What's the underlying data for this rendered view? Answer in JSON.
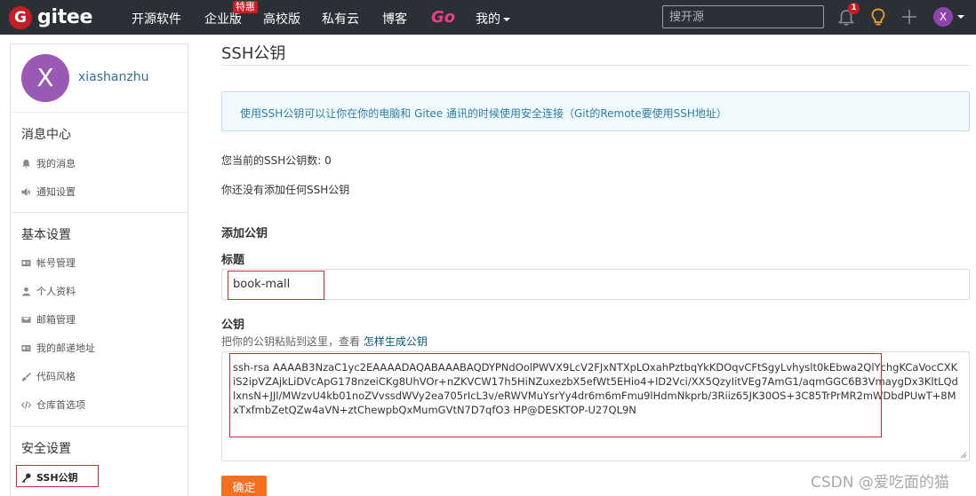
{
  "nav": {
    "brand": "gitee",
    "brand_letter": "G",
    "items": [
      "开源软件",
      "企业版",
      "高校版",
      "私有云",
      "博客"
    ],
    "badge": "特惠",
    "go_label": "Go",
    "mine": "我的",
    "search_placeholder": "搜开源",
    "notification_count": "1",
    "avatar_letter": "X"
  },
  "sidebar": {
    "avatar_letter": "X",
    "username": "xiashanzhu",
    "sections": [
      {
        "title": "消息中心",
        "items": [
          {
            "label": "我的消息",
            "icon": "bell-icon"
          },
          {
            "label": "通知设置",
            "icon": "speaker-icon"
          }
        ]
      },
      {
        "title": "基本设置",
        "items": [
          {
            "label": "帐号管理",
            "icon": "id-card-icon"
          },
          {
            "label": "个人资料",
            "icon": "user-icon"
          },
          {
            "label": "邮箱管理",
            "icon": "mail-icon"
          },
          {
            "label": "我的邮递地址",
            "icon": "address-card-icon"
          },
          {
            "label": "代码风格",
            "icon": "paint-brush-icon"
          },
          {
            "label": "仓库首选项",
            "icon": "code-icon"
          }
        ]
      },
      {
        "title": "安全设置",
        "items": [
          {
            "label": "SSH公钥",
            "icon": "key-icon",
            "active": true
          }
        ]
      }
    ]
  },
  "main": {
    "title": "SSH公钥",
    "info": "使用SSH公钥可以让你在你的电脑和 Gitee 通讯的时候使用安全连接（Git的Remote要使用SSH地址）",
    "key_count_text": "您当前的SSH公钥数: 0",
    "no_key_text": "你还没有添加任何SSH公钥",
    "add_heading": "添加公钥",
    "title_label": "标题",
    "title_value": "book-mall",
    "pubkey_label": "公钥",
    "pubkey_hint": "把你的公钥粘贴到这里，查看",
    "pubkey_hint_link": "怎样生成公钥",
    "pubkey_value": "ssh-rsa AAAAB3NzaC1yc2EAAAADAQABAAABAQDYPNdOolPWVX9LcV2FJxNTXpLOxahPztbqYkKDOqvCFtSgyLvhyslt0kEbwa2QlYchgKCaVocCXKiS2ipVZAjkLiDVcApG178nzeiCKg8UhVOr+nZKVCW17h5HiNZuxezbX5efWt5EHio4+lD2Vci/XX5QzyIitVEg7AmG1/aqmGGC6B3VmaygDx3KltLQdlxnsN+JJl/MWzvU4kb01noZVvssdWVy2ea705rIcL3v/eRWVMuYsrYy4dr6m6mFmu9lHdmNkprb/3Riiz65JK30OS+3C85TrPrMR2mWDbdPUwT+8MxTxfmbZetQZw4aVN+ztChewpbQxMumGVtN7D7qfO3 HP@DESKTOP-U27QL9N",
    "submit_label": "确定"
  },
  "watermark": "CSDN @爱吃面的猫",
  "colors": {
    "nav_bg": "#2b2f36",
    "brand_red": "#c71d23",
    "info_bg": "#f0f9fc",
    "info_text": "#2e7ea5",
    "submit_bg": "#f56f1f",
    "highlight": "#d9232e"
  }
}
